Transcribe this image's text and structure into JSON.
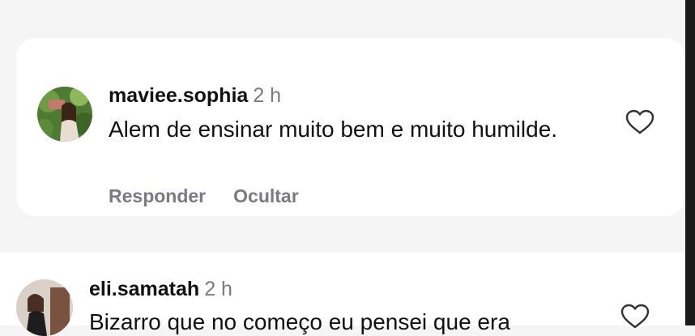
{
  "comments": [
    {
      "username": "maviee.sophia",
      "time": "2 h",
      "text": "Alem de ensinar muito bem e muito humilde.",
      "actions": {
        "reply": "Responder",
        "hide": "Ocultar"
      },
      "icon": "heart-icon"
    },
    {
      "username": "eli.samatah",
      "time": "2 h",
      "text": "Bizarro que no começo eu pensei que era",
      "icon": "heart-icon"
    }
  ],
  "colors": {
    "background": "#f5f5f5",
    "card": "#ffffff",
    "secondary_text": "#7a7a80",
    "primary_text": "#111111"
  }
}
